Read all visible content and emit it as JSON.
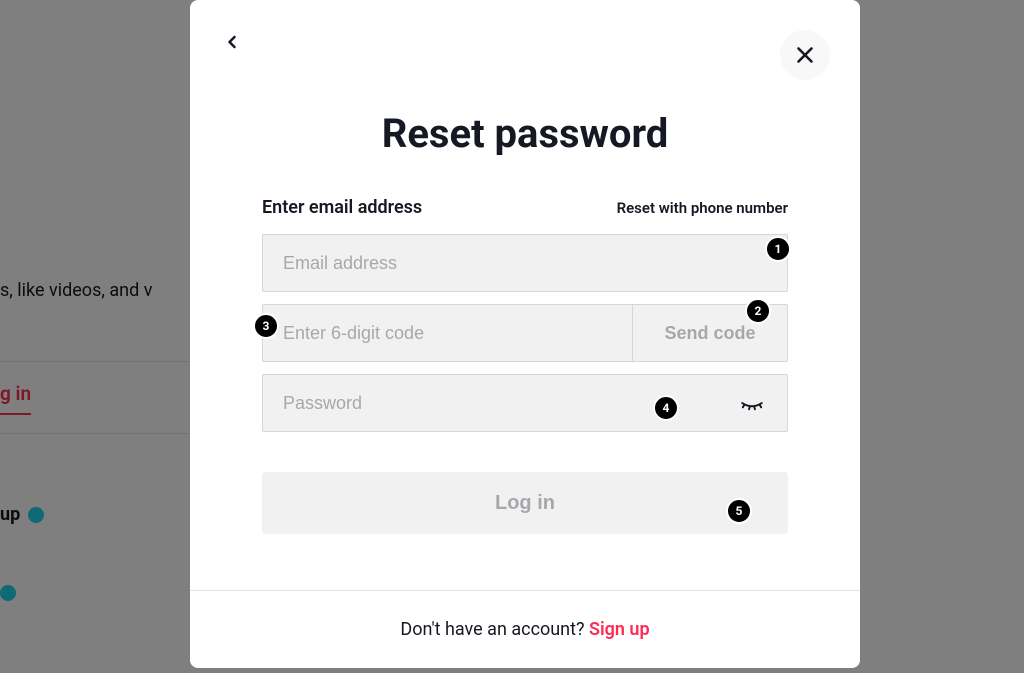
{
  "bg": {
    "text": "s, like videos, and v",
    "login": "g in",
    "up": "up"
  },
  "modal": {
    "title": "Reset password",
    "label": "Enter email address",
    "phone_link": "Reset with phone number",
    "email_placeholder": "Email address",
    "code_placeholder": "Enter 6-digit code",
    "send_label": "Send code",
    "password_placeholder": "Password",
    "login_label": "Log in",
    "footer_text": "Don't have an account? ",
    "signup_label": "Sign up"
  },
  "markers": [
    "1",
    "2",
    "3",
    "4",
    "5"
  ]
}
